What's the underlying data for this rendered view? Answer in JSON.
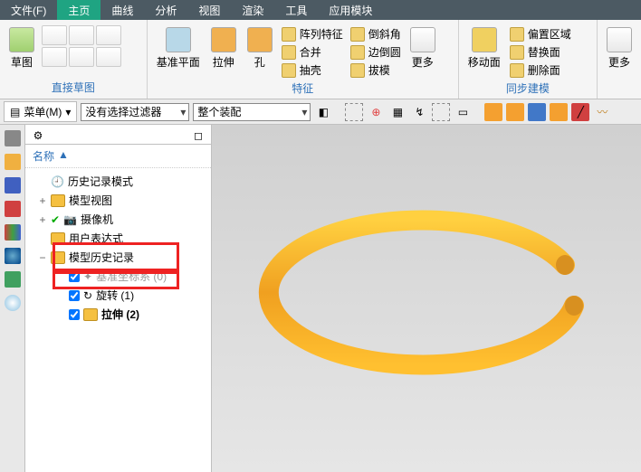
{
  "tabs": {
    "file": "文件(F)",
    "home": "主页",
    "curve": "曲线",
    "analysis": "分析",
    "view": "视图",
    "render": "渲染",
    "tool": "工具",
    "app": "应用模块"
  },
  "ribbon": {
    "sketch": {
      "label": "草图",
      "group": "直接草图"
    },
    "plane": "基准平面",
    "extrude": "拉伸",
    "hole": "孔",
    "feat": {
      "pattern": "阵列特征",
      "merge": "合并",
      "shell": "抽壳",
      "chamfer": "倒斜角",
      "edge": "边倒圆",
      "draft": "拔模",
      "group": "特征"
    },
    "more": "更多",
    "moveface": "移动面",
    "sync": {
      "offset": "偏置区域",
      "replace": "替换面",
      "delete": "删除面",
      "group": "同步建模"
    }
  },
  "filter": {
    "menu": "菜单(M)",
    "nofilter": "没有选择过滤器",
    "assembly": "整个装配"
  },
  "tree": {
    "header": "名称",
    "history": "历史记录模式",
    "modelview": "模型视图",
    "camera": "摄像机",
    "userexpr": "用户表达式",
    "modelhist": "模型历史记录",
    "datum": "基准坐标系 (0)",
    "rotate": "旋转 (1)",
    "extrude": "拉伸 (2)"
  }
}
